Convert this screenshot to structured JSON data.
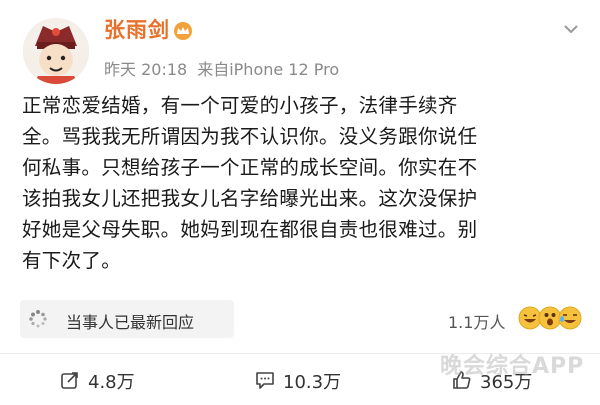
{
  "post": {
    "author": "张雨剑",
    "time": "昨天 20:18",
    "source": "来自iPhone 12 Pro",
    "text_lines": [
      "正常恋爱结婚，有一个可爱的小孩子，法律手续齐",
      "全。骂我我无所谓因为我不认识你。没义务跟你说任",
      "何私事。只想给孩子一个正常的成长空间。你实在不",
      "该拍我女儿还把我女儿名字给曝光出来。这次没保护",
      "好她是父母失职。她妈到现在都很自责也很难过。别",
      "有下次了。"
    ]
  },
  "related": {
    "label": "当事人已最新回应"
  },
  "reactions": {
    "count": "1.1万人"
  },
  "actions": {
    "repost": "4.8万",
    "comment": "10.3万",
    "like": "365万"
  },
  "watermark": "晚会综合APP",
  "colors": {
    "name": "#e8702a",
    "crown": "#f2a23a",
    "meta": "#8a8a8a"
  }
}
